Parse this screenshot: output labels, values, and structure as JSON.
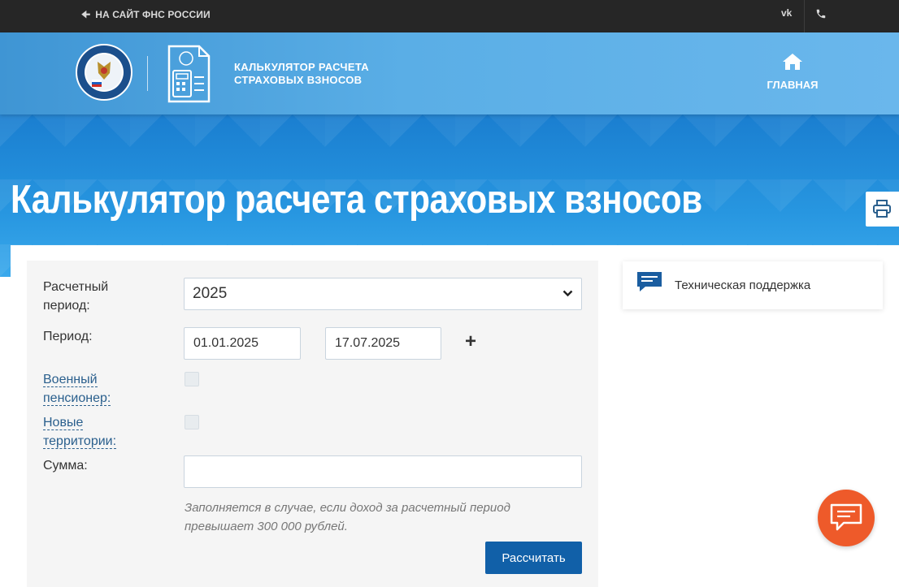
{
  "topbar": {
    "back_link": "НА САЙТ ФНС РОССИИ",
    "vk_label": "vk"
  },
  "header": {
    "site_title_line1": "КАЛЬКУЛЯТОР РАСЧЕТА",
    "site_title_line2": "СТРАХОВЫХ ВЗНОСОВ",
    "home_label": "ГЛАВНАЯ"
  },
  "page": {
    "title": "Калькулятор расчета страховых взносов"
  },
  "form": {
    "period_label_line1": "Расчетный",
    "period_label_line2": "период:",
    "period_value": "2025",
    "range_label": "Период:",
    "date_from": "01.01.2025",
    "date_to": "17.07.2025",
    "add_symbol": "+",
    "military_label_line1": "Военный",
    "military_label_line2": "пенсионер:",
    "territories_label_line1": "Новые",
    "territories_label_line2": "территории:",
    "sum_label": "Сумма:",
    "sum_value": "",
    "hint_line1": "Заполняется в случае, если доход за расчетный период",
    "hint_line2": "превышает 300 000 рублей.",
    "submit_label": "Рассчитать"
  },
  "support": {
    "label": "Техническая поддержка"
  },
  "icons": {
    "back": "arrow-left-icon",
    "vk": "vk-icon",
    "phone": "phone-icon",
    "home": "home-icon",
    "print": "printer-icon",
    "support": "chat-bubble-icon",
    "chat": "chat-icon",
    "dropdown": "chevron-down-icon"
  },
  "colors": {
    "topbar": "#262626",
    "header": "#5aaee6",
    "button": "#1160a8",
    "chat": "#ee5a2a",
    "link": "#2a5f8d"
  }
}
